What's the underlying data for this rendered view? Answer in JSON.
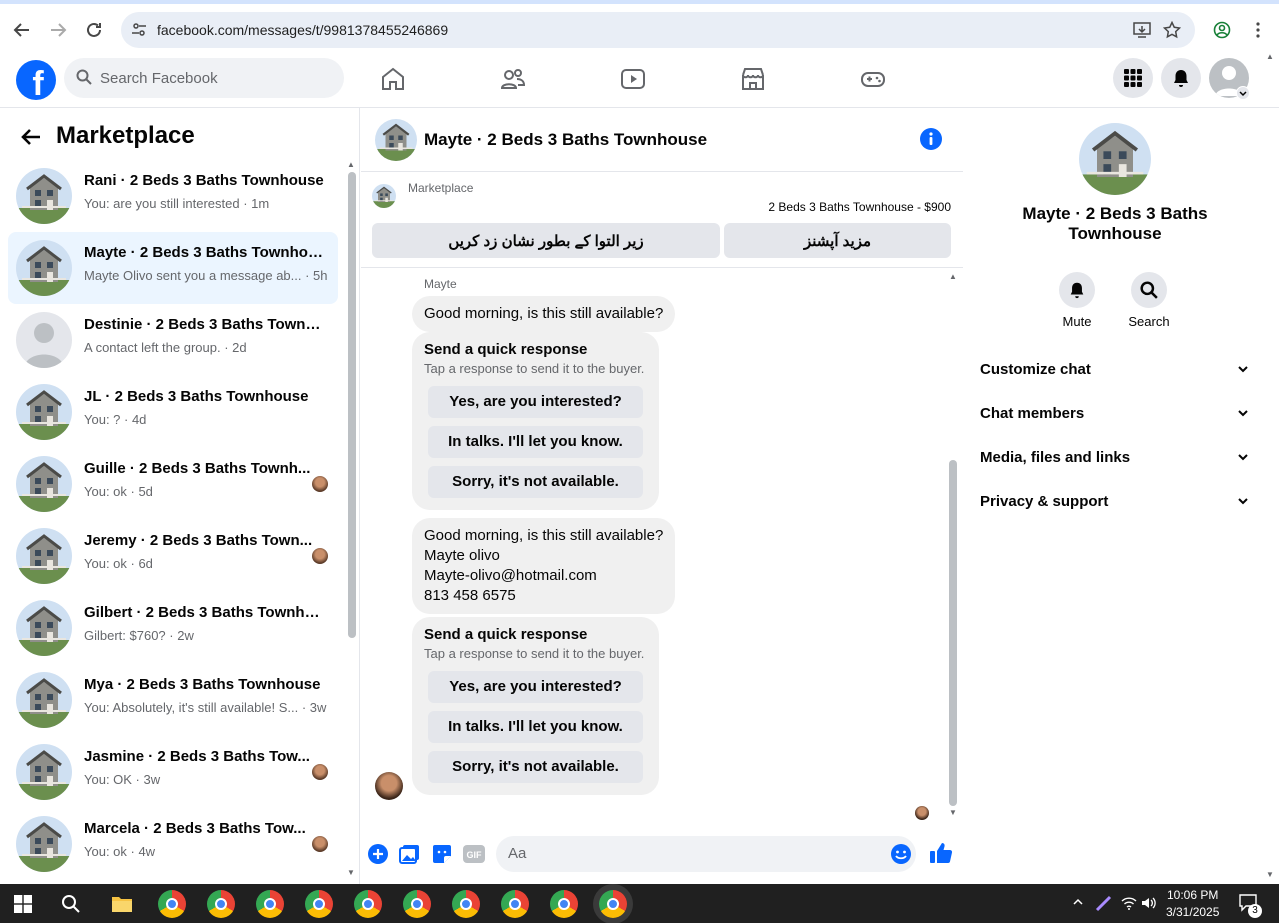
{
  "browser": {
    "url": "facebook.com/messages/t/9981378455246869"
  },
  "header": {
    "search_placeholder": "Search Facebook"
  },
  "sidebar": {
    "title": "Marketplace",
    "conversations": [
      {
        "name": "Rani · 2 Beds 3 Baths Townhouse",
        "preview": "You: are you still interested · 1m",
        "mini": false
      },
      {
        "name": "Mayte · 2 Beds 3 Baths Townhou...",
        "preview": "Mayte Olivo sent you a message ab... · 5h",
        "mini": false,
        "active": true
      },
      {
        "name": "Destinie · 2 Beds 3 Baths Townh...",
        "preview": "A contact left the group. · 2d",
        "mini": false,
        "placeholder_avatar": true
      },
      {
        "name": "JL · 2 Beds 3 Baths Townhouse",
        "preview": "You: ? · 4d",
        "mini": false
      },
      {
        "name": "Guille · 2 Beds 3 Baths Townh...",
        "preview": "You: ok · 5d",
        "mini": true
      },
      {
        "name": "Jeremy · 2 Beds 3 Baths Town...",
        "preview": "You: ok · 6d",
        "mini": true
      },
      {
        "name": "Gilbert · 2 Beds 3 Baths Townho...",
        "preview": "Gilbert: $760? · 2w",
        "mini": false
      },
      {
        "name": "Mya · 2 Beds 3 Baths Townhouse",
        "preview": "You: Absolutely, it's still available! S... · 3w",
        "mini": false
      },
      {
        "name": "Jasmine · 2 Beds 3 Baths Tow...",
        "preview": "You: OK · 3w",
        "mini": true
      },
      {
        "name": "Marcela · 2 Beds 3 Baths Tow...",
        "preview": "You: ok · 4w",
        "mini": true
      }
    ]
  },
  "chat": {
    "title": "Mayte · 2 Beds 3 Baths Townhouse",
    "marketplace_label": "Marketplace",
    "listing": "2 Beds 3 Baths Townhouse - $900",
    "btn_mark": "زیر التوا کے بطور نشان زد کریں",
    "btn_more": "مزید آپشنز",
    "sender": "Mayte",
    "msg1": "Good morning, is this still available?",
    "qr": {
      "title": "Send a quick response",
      "subtitle": "Tap a response to send it to the buyer.",
      "opt1": "Yes, are you interested?",
      "opt2": "In talks. I'll let you know.",
      "opt3": "Sorry, it's not available."
    },
    "msg2": {
      "line1": "Good morning, is this still available?",
      "line2": "Mayte olivo",
      "line3": "Mayte-olivo@hotmail.com",
      "line4": "813 458 6575"
    },
    "composer_placeholder": "Aa"
  },
  "details": {
    "name": "Mayte · 2 Beds 3 Baths Townhouse",
    "mute": "Mute",
    "search": "Search",
    "sections": [
      "Customize chat",
      "Chat members",
      "Media, files and links",
      "Privacy & support"
    ]
  },
  "taskbar": {
    "time": "10:06 PM",
    "date": "3/31/2025",
    "notifications": "3"
  },
  "colors": {
    "accent": "#0866ff",
    "active_row": "#ebf5ff"
  }
}
